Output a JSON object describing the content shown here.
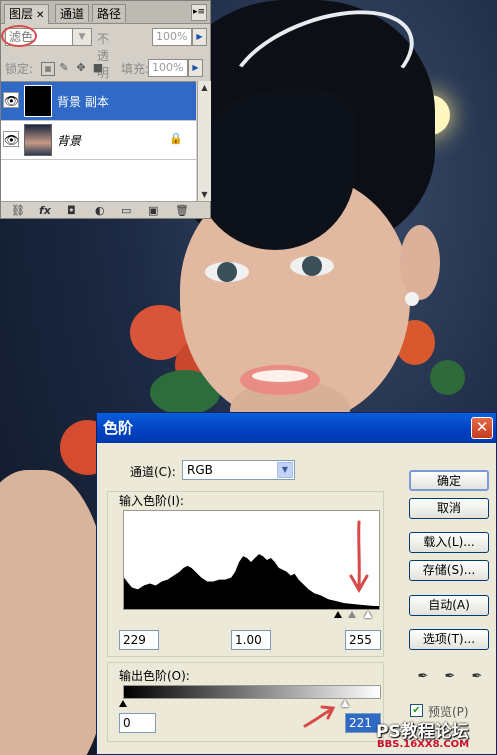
{
  "layers_panel": {
    "tabs": [
      {
        "label": "图层",
        "active": true
      },
      {
        "label": "通道",
        "active": false
      },
      {
        "label": "路径",
        "active": false
      }
    ],
    "blend_mode": "滤色",
    "opacity_label": "不透明度:",
    "opacity_value": "100%",
    "lock_label": "锁定:",
    "fill_label": "填充:",
    "fill_value": "100%",
    "layers": [
      {
        "name": "背景 副本",
        "selected": true,
        "visible": true
      },
      {
        "name": "背景",
        "selected": false,
        "visible": true,
        "locked": true
      }
    ],
    "bottom_icons": [
      "link-icon",
      "fx-icon",
      "mask-icon",
      "adjustment-icon",
      "group-icon",
      "new-layer-icon",
      "trash-icon"
    ]
  },
  "levels_dialog": {
    "title": "色阶",
    "channel_label": "通道(C):",
    "channel_value": "RGB",
    "input_levels_label": "输入色阶(I):",
    "input_black": "229",
    "input_gamma": "1.00",
    "input_white": "255",
    "output_levels_label": "输出色阶(O):",
    "output_black": "0",
    "output_white": "221",
    "buttons": {
      "ok": "确定",
      "cancel": "取消",
      "load": "载入(L)...",
      "save": "存储(S)...",
      "auto": "自动(A)",
      "options": "选项(T)..."
    },
    "preview_label": "预览(P)",
    "preview_checked": true
  },
  "watermark": {
    "line1": "PS教程论坛",
    "line2": "BBS.16XX8.COM"
  },
  "colors": {
    "selection_blue": "#3169c6",
    "dialog_title": "#0a5fdb",
    "annotation_red": "#d84a4a"
  }
}
